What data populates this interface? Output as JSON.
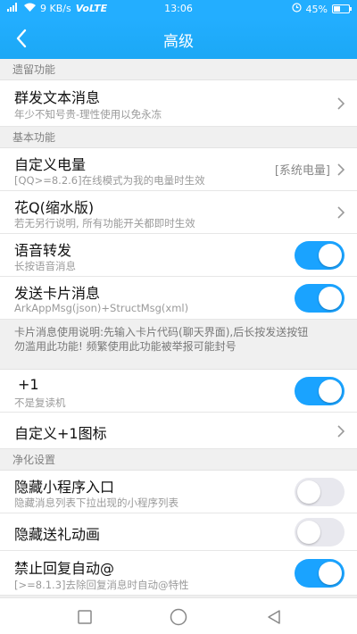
{
  "status_bar": {
    "speed": "9 KB/s",
    "network": "VoLTE",
    "time": "13:06",
    "battery": "45%",
    "battery_level": 0.45
  },
  "title_bar": {
    "title": "高级"
  },
  "sections": {
    "legacy": {
      "header": "遗留功能",
      "group_message": {
        "title": "群发文本消息",
        "subtitle": "年少不知号贵-理性使用以免永冻"
      }
    },
    "basic": {
      "header": "基本功能",
      "custom_battery": {
        "title": "自定义电量",
        "subtitle": "[QQ>=8.2.6]在线模式为我的电量时生效",
        "value": "[系统电量]"
      },
      "flower_q": {
        "title": "花Q(缩水版)",
        "subtitle": "若无另行说明, 所有功能开关都即时生效"
      },
      "voice_forward": {
        "title": "语音转发",
        "subtitle": "长按语音消息",
        "enabled": true
      },
      "send_card": {
        "title": "发送卡片消息",
        "subtitle": "ArkAppMsg(json)+StructMsg(xml)",
        "enabled": true
      },
      "card_notice": {
        "line1": "卡片消息使用说明:先输入卡片代码(聊天界面),后长按发送按钮",
        "line2": "勿滥用此功能! 频繁使用此功能被举报可能封号"
      },
      "plus_one": {
        "title": "+1",
        "subtitle": "不是复读机",
        "enabled": true
      },
      "custom_plus_one_icon": {
        "title": "自定义+1图标"
      }
    },
    "purify": {
      "header": "净化设置",
      "hide_miniapp": {
        "title": "隐藏小程序入口",
        "subtitle": "隐藏消息列表下拉出现的小程序列表",
        "enabled": false
      },
      "hide_gift_anim": {
        "title": "隐藏送礼动画",
        "enabled": false
      },
      "disable_auto_at": {
        "title": "禁止回复自动@",
        "subtitle": "[>=8.1.3]去除回复消息时自动@特性",
        "enabled": true
      }
    }
  },
  "colors": {
    "accent": "#23aeff",
    "toggle_on": "#1aa3ff",
    "toggle_off": "#e8e8ee"
  },
  "icons": {
    "back": "back-arrow-icon",
    "chevron": "chevron-right-icon",
    "nav_recent": "square-icon",
    "nav_home": "circle-icon",
    "nav_back": "triangle-back-icon"
  }
}
